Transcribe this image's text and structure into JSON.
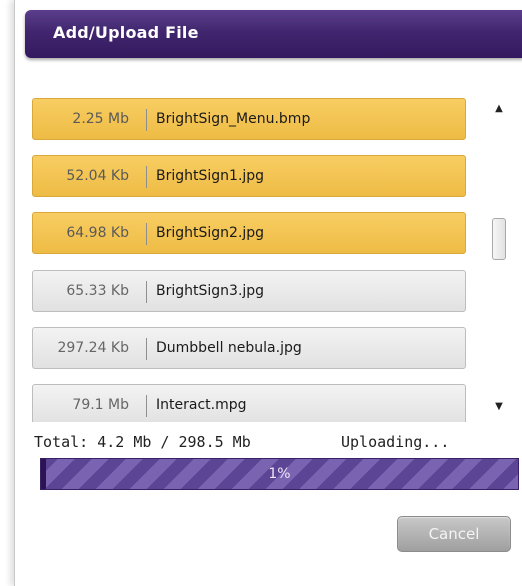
{
  "dialog": {
    "title": "Add/Upload File"
  },
  "files": [
    {
      "size": "2.25 Mb",
      "name": "BrightSign_Menu.bmp",
      "selected": true
    },
    {
      "size": "52.04 Kb",
      "name": "BrightSign1.jpg",
      "selected": true
    },
    {
      "size": "64.98 Kb",
      "name": "BrightSign2.jpg",
      "selected": true
    },
    {
      "size": "65.33 Kb",
      "name": "BrightSign3.jpg",
      "selected": false
    },
    {
      "size": "297.24 Kb",
      "name": "Dumbbell nebula.jpg",
      "selected": false
    },
    {
      "size": "79.1 Mb",
      "name": "Interact.mpg",
      "selected": false
    }
  ],
  "scrollbar": {
    "up_icon": "triangle-up",
    "down_icon": "triangle-down"
  },
  "summary": {
    "total_text": "Total: 4.2 Mb / 298.5 Mb",
    "status_text": "Uploading..."
  },
  "progress": {
    "percent": 1,
    "label": "1%"
  },
  "buttons": {
    "cancel_label": "Cancel"
  },
  "colors": {
    "titlebar": "#41266f",
    "selected_row": "#f2c24f",
    "progress_bar": "#5d4596"
  }
}
